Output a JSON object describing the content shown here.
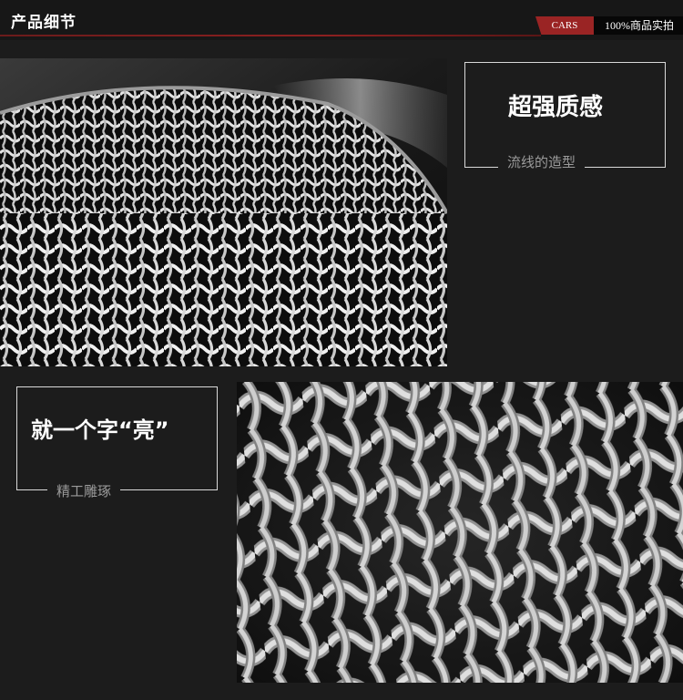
{
  "header": {
    "title": "产品细节",
    "tag_brand": "CARS",
    "tag_real": "100%商品实拍"
  },
  "feature1": {
    "title": "超强质感",
    "subtitle": "流线的造型"
  },
  "feature2": {
    "title": "就一个字“亮”",
    "subtitle": "精工雕琢"
  },
  "colors": {
    "background": "#1c1c1c",
    "accent": "#9a2424",
    "text": "#ffffff",
    "muted_text": "#9a9a9a"
  }
}
